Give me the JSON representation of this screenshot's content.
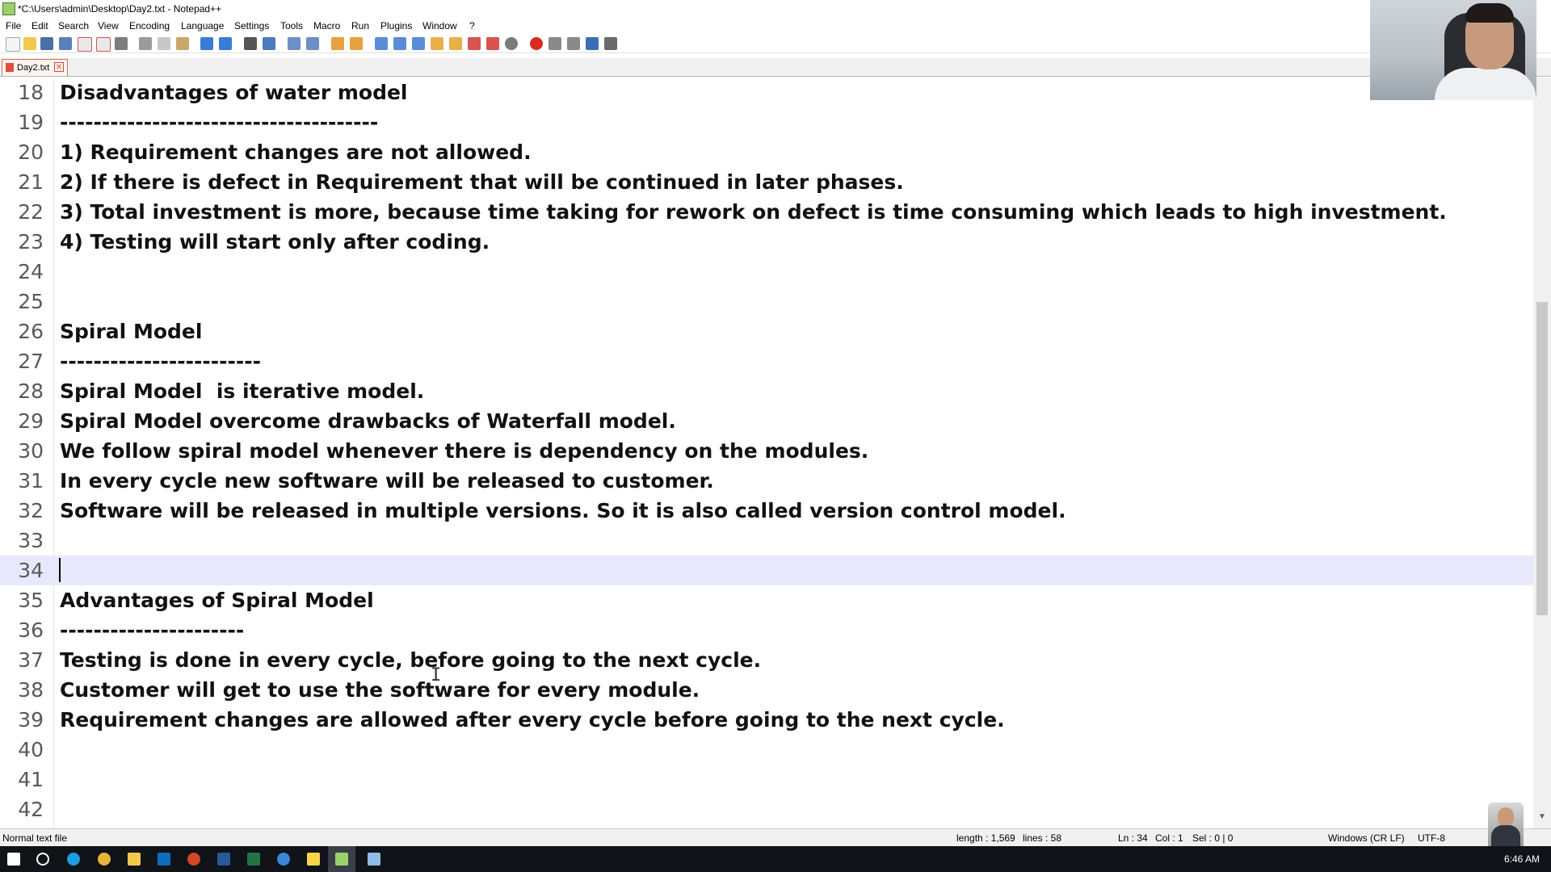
{
  "window": {
    "title": "*C:\\Users\\admin\\Desktop\\Day2.txt - Notepad++"
  },
  "menu": [
    "File",
    "Edit",
    "Search",
    "View",
    "Encoding",
    "Language",
    "Settings",
    "Tools",
    "Macro",
    "Run",
    "Plugins",
    "Window",
    "?"
  ],
  "toolbar_icons": [
    "new-file-icon",
    "open-file-icon",
    "save-icon",
    "save-all-icon",
    "close-icon",
    "close-all-icon",
    "print-icon",
    "cut-icon",
    "copy-icon",
    "paste-icon",
    "undo-icon",
    "redo-icon",
    "find-icon",
    "replace-icon",
    "zoom-in-icon",
    "zoom-out-icon",
    "sync-vertical-icon",
    "sync-horizontal-icon",
    "word-wrap-icon",
    "show-all-chars-icon",
    "indent-guide-icon",
    "doc-map-icon",
    "function-list-icon",
    "folder-workspace-icon",
    "monitoring-icon",
    "preview-icon",
    "record-macro-icon",
    "stop-record-icon",
    "play-macro-icon",
    "run-multiple-icon",
    "save-macro-icon"
  ],
  "tab": {
    "name": "Day2.txt"
  },
  "editor": {
    "current_line": 34,
    "lines": [
      {
        "n": "18",
        "text": "Disadvantages of water model"
      },
      {
        "n": "19",
        "text": "--------------------------------------"
      },
      {
        "n": "20",
        "text": "1) Requirement changes are not allowed."
      },
      {
        "n": "21",
        "text": "2) If there is defect in Requirement that will be continued in later phases."
      },
      {
        "n": "22",
        "text": "3) Total investment is more, because time taking for rework on defect is time consuming which leads to high investment."
      },
      {
        "n": "23",
        "text": "4) Testing will start only after coding."
      },
      {
        "n": "24",
        "text": ""
      },
      {
        "n": "25",
        "text": ""
      },
      {
        "n": "26",
        "text": "Spiral Model"
      },
      {
        "n": "27",
        "text": "------------------------"
      },
      {
        "n": "28",
        "text": "Spiral Model  is iterative model."
      },
      {
        "n": "29",
        "text": "Spiral Model overcome drawbacks of Waterfall model."
      },
      {
        "n": "30",
        "text": "We follow spiral model whenever there is dependency on the modules."
      },
      {
        "n": "31",
        "text": "In every cycle new software will be released to customer."
      },
      {
        "n": "32",
        "text": "Software will be released in multiple versions. So it is also called version control model."
      },
      {
        "n": "33",
        "text": ""
      },
      {
        "n": "34",
        "text": ""
      },
      {
        "n": "35",
        "text": "Advantages of Spiral Model"
      },
      {
        "n": "36",
        "text": "----------------------"
      },
      {
        "n": "37",
        "text": "Testing is done in every cycle, before going to the next cycle."
      },
      {
        "n": "38",
        "text": "Customer will get to use the software for every module."
      },
      {
        "n": "39",
        "text": "Requirement changes are allowed after every cycle before going to the next cycle."
      },
      {
        "n": "40",
        "text": ""
      },
      {
        "n": "41",
        "text": ""
      },
      {
        "n": "42",
        "text": ""
      }
    ]
  },
  "status": {
    "file_type": "Normal text file",
    "length": "length : 1,569",
    "lines": "lines : 58",
    "ln": "Ln : 34",
    "col": "Col : 1",
    "sel": "Sel : 0 | 0",
    "eol": "Windows (CR LF)",
    "encoding": "UTF-8"
  },
  "taskbar": {
    "icons": [
      "windows-start-icon",
      "search-icon",
      "edge-icon",
      "chrome-icon",
      "file-explorer-icon",
      "outlook-icon",
      "powerpoint-icon",
      "word-icon",
      "excel-icon",
      "webcam-app-icon",
      "sticky-notes-icon",
      "notepadpp-icon",
      "notepad-icon"
    ],
    "time": "6:46 AM"
  }
}
